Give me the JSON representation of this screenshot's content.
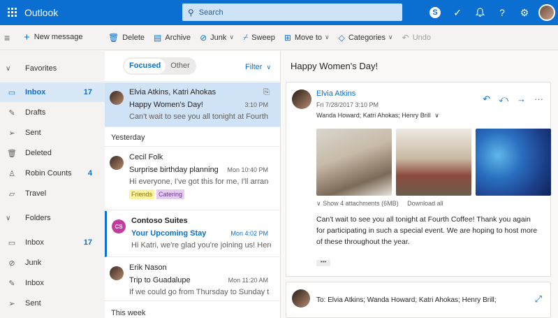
{
  "topbar": {
    "app_title": "Outlook",
    "search_placeholder": "Search",
    "icons": [
      "waffle-icon",
      "skype-icon",
      "checkmark-icon",
      "bell-icon",
      "help-icon",
      "gear-icon",
      "avatar"
    ]
  },
  "commands": {
    "new_message": "New message",
    "delete": "Delete",
    "archive": "Archive",
    "junk": "Junk",
    "sweep": "Sweep",
    "move_to": "Move to",
    "categories": "Categories",
    "undo": "Undo"
  },
  "nav": {
    "favorites_label": "Favorites",
    "folders_label": "Folders",
    "favorites": [
      {
        "label": "Inbox",
        "count": "17"
      },
      {
        "label": "Drafts",
        "count": ""
      },
      {
        "label": "Sent",
        "count": ""
      },
      {
        "label": "Deleted",
        "count": ""
      },
      {
        "label": "Robin Counts",
        "count": "4"
      },
      {
        "label": "Travel",
        "count": ""
      }
    ],
    "folders": [
      {
        "label": "Inbox",
        "count": "17"
      },
      {
        "label": "Junk",
        "count": ""
      },
      {
        "label": "Inbox",
        "count": ""
      },
      {
        "label": "Sent",
        "count": ""
      }
    ]
  },
  "list": {
    "tab_focused": "Focused",
    "tab_other": "Other",
    "filter": "Filter",
    "group_yesterday": "Yesterday",
    "group_this_week": "This week",
    "messages": [
      {
        "from": "Elvia Atkins, Katri Ahokas",
        "subject": "Happy Women's Day!",
        "time": "3:10 PM",
        "preview": "Can't wait to see you all tonight at Fourth"
      },
      {
        "from": "Cecil Folk",
        "subject": "Surprise birthday planning",
        "time": "Mon 10:40 PM",
        "preview": "Hi everyone, I've got this for me, I'll arrange for",
        "tags": [
          "Friends",
          "Catering"
        ]
      },
      {
        "from": "Contoso Suites",
        "initials": "CS",
        "subject": "Your Upcoming Stay",
        "time": "Mon 4:02 PM",
        "preview": "Hi Katri, we're glad you're joining us! Here is"
      },
      {
        "from": "Erik Nason",
        "subject": "Trip to Guadalupe",
        "time": "Mon 11:20 AM",
        "preview": "If we could go from Thursday to Sunday that"
      }
    ]
  },
  "reading": {
    "title": "Happy Women's Day!",
    "sender": "Elvia Atkins",
    "date": "Fri 7/28/2017 3:10 PM",
    "recipients": "Wanda Howard; Katri Ahokas; Henry Brill",
    "attachments": "Show 4 attachments (6MB)",
    "download_all": "Download all",
    "body": "Can't wait to see you all tonight at Fourth Coffee! Thank you again for participating in such a special event. We are hoping to host more of these throughout the year.",
    "ellipsis": "•••",
    "reply_to": "To: Elvia Atkins; Wanda Howard; Katri Ahokas; Henry Brill;"
  },
  "colors": {
    "accent": "#0a6fd1",
    "selected": "#d0e3f6"
  }
}
